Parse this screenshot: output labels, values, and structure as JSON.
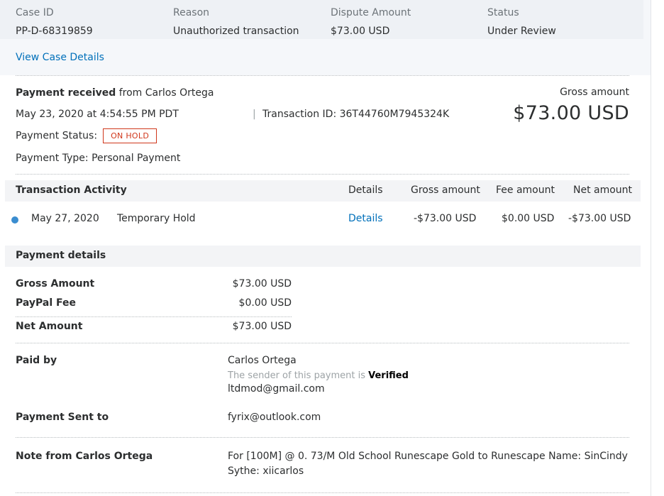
{
  "case": {
    "case_id_label": "Case ID",
    "case_id": "PP-D-68319859",
    "reason_label": "Reason",
    "reason": "Unauthorized transaction",
    "dispute_label": "Dispute Amount",
    "dispute_amount": "$73.00 USD",
    "status_label": "Status",
    "status": "Under Review",
    "view_link": "View Case Details"
  },
  "summary": {
    "received_bold": "Payment received",
    "received_from": " from Carlos Ortega",
    "date": "May 23, 2020 at 4:54:55 PM PDT",
    "separator": "|",
    "transaction_id": "Transaction ID: 36T44760M7945324K",
    "status_label": "Payment Status:",
    "status_badge": "ON HOLD",
    "payment_type": "Payment Type: Personal Payment",
    "gross_label": "Gross amount",
    "gross_value": "$73.00 USD"
  },
  "activity": {
    "title": "Transaction Activity",
    "headers": {
      "details": "Details",
      "gross": "Gross amount",
      "fee": "Fee amount",
      "net": "Net amount"
    },
    "rows": [
      {
        "date": "May 27, 2020",
        "description": "Temporary Hold",
        "details": "Details",
        "gross": "-$73.00 USD",
        "fee": "$0.00 USD",
        "net": "-$73.00 USD"
      }
    ]
  },
  "payment_details": {
    "title": "Payment details",
    "gross_label": "Gross Amount",
    "gross_value": "$73.00 USD",
    "fee_label": "PayPal Fee",
    "fee_value": "$0.00 USD",
    "net_label": "Net Amount",
    "net_value": "$73.00 USD",
    "paid_by_label": "Paid by",
    "paid_by_name": "Carlos Ortega",
    "verified_prefix": "The sender of this payment is ",
    "verified_word": "Verified",
    "paid_by_email": "ltdmod@gmail.com",
    "sent_to_label": "Payment Sent to",
    "sent_to_email": "fyrix@outlook.com",
    "note_label": "Note from Carlos Ortega",
    "note_line1": "For [100M] @ 0. 73/M Old School Runescape Gold to Runescape Name: SinCindy",
    "note_line2": "Sythe: xiicarlos"
  },
  "colors": {
    "link": "#0070ba",
    "on_hold": "#d0371b",
    "activity_dot": "#3a8dd0",
    "header_bg": "#f3f4f6"
  }
}
